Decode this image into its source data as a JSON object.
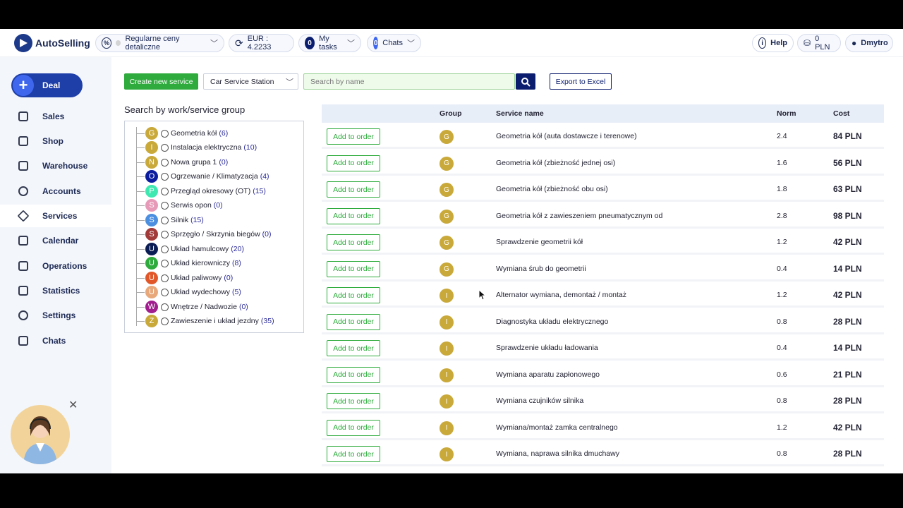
{
  "header": {
    "logo_text": "AutoSelling",
    "price_mode": "Regularne ceny detaliczne",
    "currency": "EUR : 4.2233",
    "tasks_count": "0",
    "tasks_label": "My tasks",
    "chats_count": "0",
    "chats_label": "Chats",
    "help_label": "Help",
    "balance": "0 PLN",
    "user": "Dmytro"
  },
  "sidebar": {
    "deal_label": "Deal",
    "items": [
      {
        "label": "Sales",
        "icon": "bag-icon"
      },
      {
        "label": "Shop",
        "icon": "store-icon"
      },
      {
        "label": "Warehouse",
        "icon": "warehouse-icon"
      },
      {
        "label": "Accounts",
        "icon": "users-icon"
      },
      {
        "label": "Services",
        "icon": "star-icon"
      },
      {
        "label": "Calendar",
        "icon": "calendar-icon"
      },
      {
        "label": "Operations",
        "icon": "grid-icon"
      },
      {
        "label": "Statistics",
        "icon": "chart-icon"
      },
      {
        "label": "Settings",
        "icon": "gear-icon"
      },
      {
        "label": "Chats",
        "icon": "chat-icon"
      }
    ]
  },
  "toolbar": {
    "create_label": "Create new service",
    "station_select": "Car Service Station",
    "search_placeholder": "Search by name",
    "export_label": "Export to Excel"
  },
  "tree": {
    "title": "Search by work/service group",
    "groups": [
      {
        "letter": "G",
        "color": "#c9a93a",
        "label": "Geometria kół",
        "count": "(6)"
      },
      {
        "letter": "I",
        "color": "#c9a93a",
        "label": "Instalacja elektryczna",
        "count": "(10)"
      },
      {
        "letter": "N",
        "color": "#c9a93a",
        "label": "Nowa grupa 1",
        "count": "(0)"
      },
      {
        "letter": "O",
        "color": "#0b1d9e",
        "label": "Ogrzewanie / Klimatyzacja",
        "count": "(4)"
      },
      {
        "letter": "P",
        "color": "#3ee8b0",
        "label": "Przegląd okresowy (OT)",
        "count": "(15)"
      },
      {
        "letter": "S",
        "color": "#e79ab8",
        "label": "Serwis opon",
        "count": "(0)"
      },
      {
        "letter": "S",
        "color": "#4a8fe0",
        "label": "Silnik",
        "count": "(15)"
      },
      {
        "letter": "S",
        "color": "#a33a3a",
        "label": "Sprzęgło / Skrzynia biegów",
        "count": "(0)"
      },
      {
        "letter": "U",
        "color": "#0b1d55",
        "label": "Układ hamulcowy",
        "count": "(20)"
      },
      {
        "letter": "U",
        "color": "#2eab3c",
        "label": "Układ kierowniczy",
        "count": "(8)"
      },
      {
        "letter": "U",
        "color": "#e2572a",
        "label": "Układ paliwowy",
        "count": "(0)"
      },
      {
        "letter": "U",
        "color": "#e8a87a",
        "label": "Układ wydechowy",
        "count": "(5)"
      },
      {
        "letter": "W",
        "color": "#a01e8e",
        "label": "Wnętrze / Nadwozie",
        "count": "(0)"
      },
      {
        "letter": "Z",
        "color": "#c9a93a",
        "label": "Zawieszenie i układ jezdny",
        "count": "(35)"
      }
    ]
  },
  "table": {
    "headers": {
      "group": "Group",
      "service": "Service name",
      "norm": "Norm",
      "cost": "Cost"
    },
    "add_label": "Add to order",
    "rows": [
      {
        "group": "G",
        "service": "Geometria kół (auta dostawcze i terenowe)",
        "norm": "2.4",
        "cost": "84 PLN"
      },
      {
        "group": "G",
        "service": "Geometria kół (zbieżność jednej osi)",
        "norm": "1.6",
        "cost": "56 PLN"
      },
      {
        "group": "G",
        "service": "Geometria kół (zbieżność obu osi)",
        "norm": "1.8",
        "cost": "63 PLN"
      },
      {
        "group": "G",
        "service": "Geometria kół z zawieszeniem pneumatycznym od",
        "norm": "2.8",
        "cost": "98 PLN"
      },
      {
        "group": "G",
        "service": "Sprawdzenie geometrii kół",
        "norm": "1.2",
        "cost": "42 PLN"
      },
      {
        "group": "G",
        "service": "Wymiana śrub do geometrii",
        "norm": "0.4",
        "cost": "14 PLN"
      },
      {
        "group": "I",
        "service": "Alternator wymiana, demontaż / montaż",
        "norm": "1.2",
        "cost": "42 PLN"
      },
      {
        "group": "I",
        "service": "Diagnostyka układu elektrycznego",
        "norm": "0.8",
        "cost": "28 PLN"
      },
      {
        "group": "I",
        "service": "Sprawdzenie układu ładowania",
        "norm": "0.4",
        "cost": "14 PLN"
      },
      {
        "group": "I",
        "service": "Wymiana aparatu zapłonowego",
        "norm": "0.6",
        "cost": "21 PLN"
      },
      {
        "group": "I",
        "service": "Wymiana czujników silnika",
        "norm": "0.8",
        "cost": "28 PLN"
      },
      {
        "group": "I",
        "service": "Wymiana/montaż zamka centralnego",
        "norm": "1.2",
        "cost": "42 PLN"
      },
      {
        "group": "I",
        "service": "Wymiana, naprawa silnika dmuchawy",
        "norm": "0.8",
        "cost": "28 PLN"
      }
    ]
  }
}
